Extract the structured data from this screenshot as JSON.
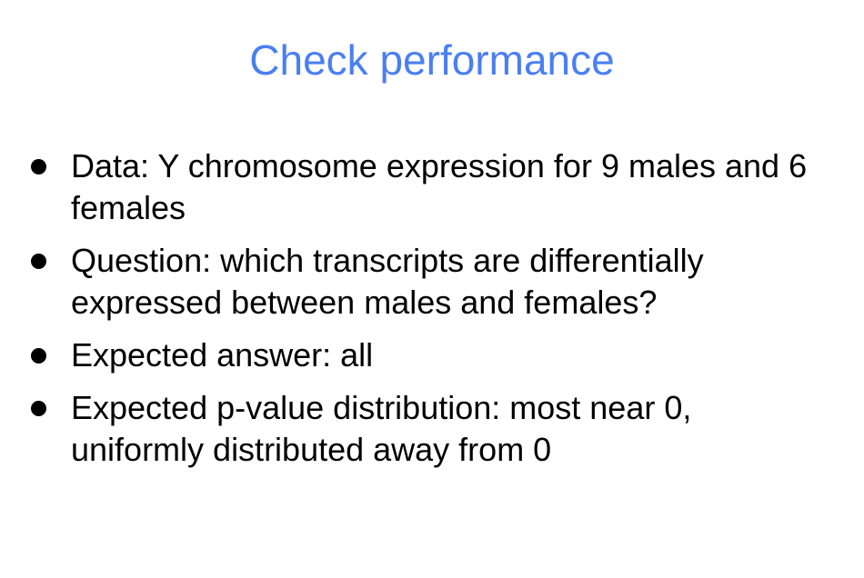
{
  "slide": {
    "title": "Check performance",
    "title_color": "#4a7ff2",
    "bullets": [
      "Data: Y chromosome expression for 9 males and 6 females",
      "Question: which transcripts are differentially expressed between males and females?",
      "Expected answer: all",
      "Expected p-value distribution: most near 0, uniformly distributed away from 0"
    ]
  }
}
